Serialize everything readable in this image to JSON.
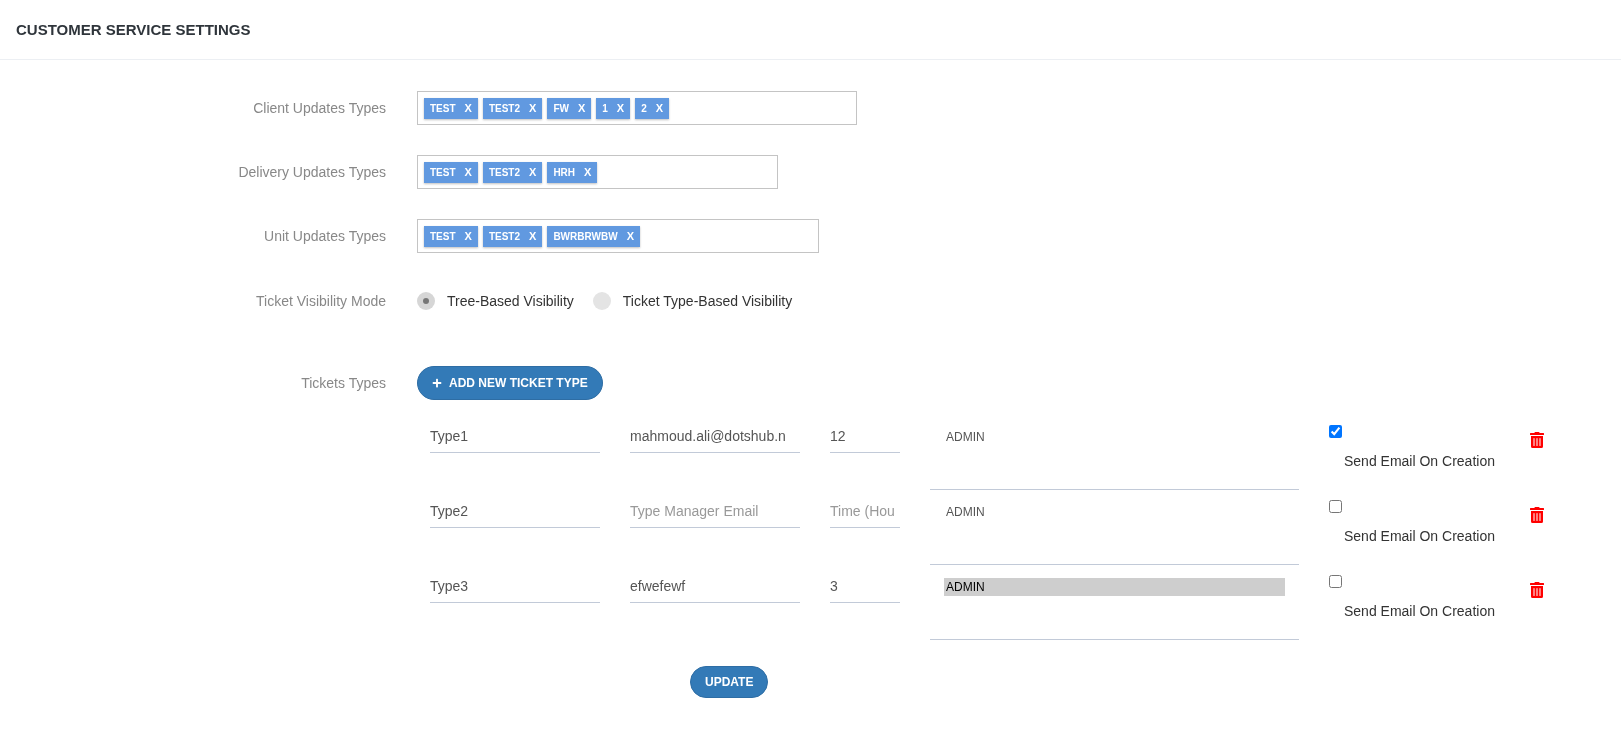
{
  "header": {
    "title": "CUSTOMER SERVICE SETTINGS"
  },
  "tag_fields": [
    {
      "label": "Client Updates Types",
      "tags": [
        {
          "text": "TEST",
          "remove": "X"
        },
        {
          "text": "TEST2",
          "remove": "X"
        },
        {
          "text": "FW",
          "remove": "X"
        },
        {
          "text": "1",
          "remove": "X"
        },
        {
          "text": "2",
          "remove": "X"
        }
      ]
    },
    {
      "label": "Delivery Updates Types",
      "tags": [
        {
          "text": "TEST",
          "remove": "X"
        },
        {
          "text": "TEST2",
          "remove": "X"
        },
        {
          "text": "HRH",
          "remove": "X"
        }
      ]
    },
    {
      "label": "Unit Updates Types",
      "tags": [
        {
          "text": "TEST",
          "remove": "X"
        },
        {
          "text": "TEST2",
          "remove": "X"
        },
        {
          "text": "BWRBRWBW",
          "remove": "X"
        }
      ]
    }
  ],
  "visibility": {
    "label": "Ticket Visibility Mode",
    "options": [
      {
        "label": "Tree-Based Visibility",
        "selected": true
      },
      {
        "label": "Ticket Type-Based Visibility",
        "selected": false
      }
    ]
  },
  "ticket_types": {
    "label": "Tickets Types",
    "add_button": "ADD NEW TICKET TYPE",
    "rows": [
      {
        "name": {
          "value": "Type1"
        },
        "email": {
          "value": "mahmoud.ali@dotshub.n"
        },
        "time": {
          "value": "12"
        },
        "roles": [
          {
            "label": "ADMIN",
            "selected": false
          }
        ],
        "send_email": {
          "label": "Send Email On Creation",
          "checked": true
        }
      },
      {
        "name": {
          "value": "Type2"
        },
        "email": {
          "placeholder": "Type Manager Email"
        },
        "time": {
          "placeholder": "Time (Hou"
        },
        "roles": [
          {
            "label": "ADMIN",
            "selected": false
          }
        ],
        "send_email": {
          "label": "Send Email On Creation",
          "checked": false
        }
      },
      {
        "name": {
          "value": "Type3"
        },
        "email": {
          "value": "efwefewf"
        },
        "time": {
          "value": "3"
        },
        "roles": [
          {
            "label": "ADMIN",
            "selected": true
          }
        ],
        "send_email": {
          "label": "Send Email On Creation",
          "checked": false
        }
      }
    ]
  },
  "update_button": "UPDATE"
}
